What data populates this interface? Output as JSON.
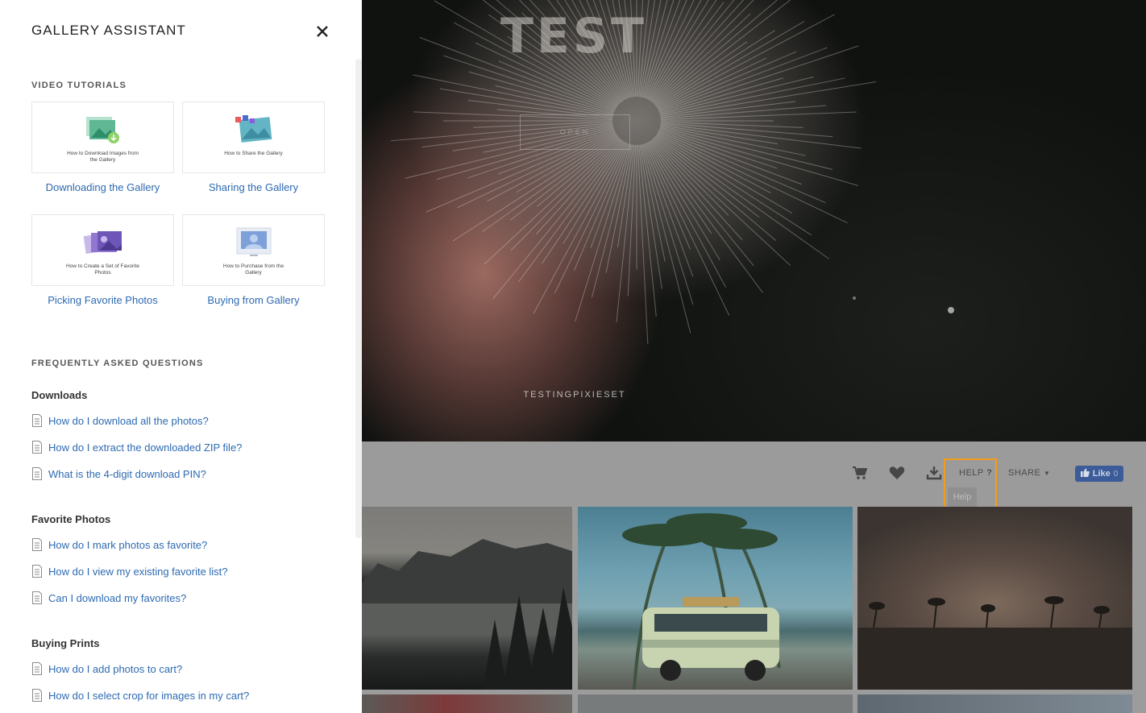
{
  "gallery": {
    "hero_title": "TEST",
    "hero_open": "OPEN",
    "hero_subtitle": "TESTINGPIXIESET",
    "toolbar": {
      "help_label": "HELP",
      "help_mark": "?",
      "share_label": "SHARE",
      "help_tooltip": "Help",
      "like_label": "Like",
      "like_count": "0"
    },
    "icons": [
      "cart-icon",
      "heart-icon",
      "download-icon",
      "chevron-down-icon",
      "facebook-thumb-icon"
    ],
    "highlight_color": "#f39b1b"
  },
  "panel": {
    "title": "GALLERY ASSISTANT",
    "close_icon": "close-icon",
    "video_section": "VIDEO TUTORIALS",
    "tutorials": [
      {
        "label": "Downloading the Gallery",
        "caption": "How to Download Images from the Gallery",
        "icon": "download-images-illustration"
      },
      {
        "label": "Sharing the Gallery",
        "caption": "How to Share the Gallery",
        "icon": "share-gallery-illustration"
      },
      {
        "label": "Picking Favorite Photos",
        "caption": "How to Create a Set of Favorite Photos",
        "icon": "favorite-photos-illustration"
      },
      {
        "label": "Buying from Gallery",
        "caption": "How to Purchase from the Gallery",
        "icon": "purchase-illustration"
      }
    ],
    "faq_section": "FREQUENTLY ASKED QUESTIONS",
    "faq_groups": [
      {
        "title": "Downloads",
        "items": [
          "How do I download all the photos?",
          "How do I extract the downloaded ZIP file?",
          "What is the 4-digit download PIN?"
        ]
      },
      {
        "title": "Favorite Photos",
        "items": [
          "How do I mark photos as favorite?",
          "How do I view my existing favorite list?",
          "Can I download my favorites?"
        ]
      },
      {
        "title": "Buying Prints",
        "items": [
          "How do I add photos to cart?",
          "How do I select crop for images in my cart?"
        ]
      }
    ],
    "link_color": "#2d6ab2"
  }
}
